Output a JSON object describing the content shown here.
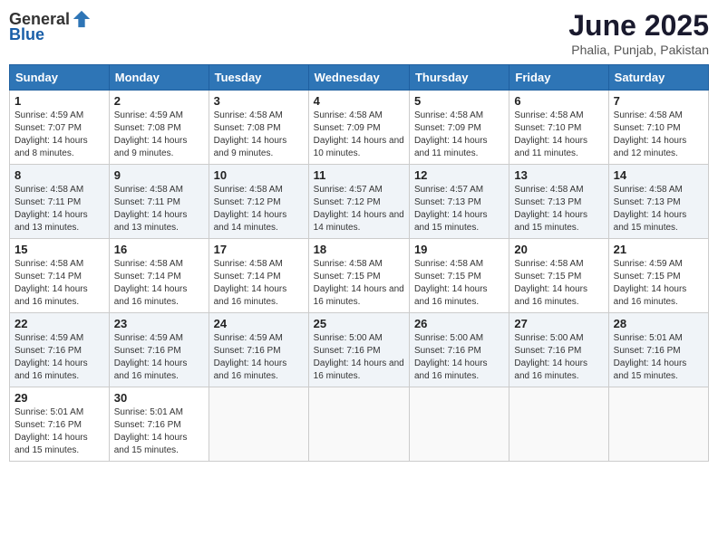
{
  "header": {
    "logo_general": "General",
    "logo_blue": "Blue",
    "month_year": "June 2025",
    "location": "Phalia, Punjab, Pakistan"
  },
  "days_of_week": [
    "Sunday",
    "Monday",
    "Tuesday",
    "Wednesday",
    "Thursday",
    "Friday",
    "Saturday"
  ],
  "weeks": [
    [
      {
        "day": "1",
        "sunrise": "4:59 AM",
        "sunset": "7:07 PM",
        "daylight": "14 hours and 8 minutes."
      },
      {
        "day": "2",
        "sunrise": "4:59 AM",
        "sunset": "7:08 PM",
        "daylight": "14 hours and 9 minutes."
      },
      {
        "day": "3",
        "sunrise": "4:58 AM",
        "sunset": "7:08 PM",
        "daylight": "14 hours and 9 minutes."
      },
      {
        "day": "4",
        "sunrise": "4:58 AM",
        "sunset": "7:09 PM",
        "daylight": "14 hours and 10 minutes."
      },
      {
        "day": "5",
        "sunrise": "4:58 AM",
        "sunset": "7:09 PM",
        "daylight": "14 hours and 11 minutes."
      },
      {
        "day": "6",
        "sunrise": "4:58 AM",
        "sunset": "7:10 PM",
        "daylight": "14 hours and 11 minutes."
      },
      {
        "day": "7",
        "sunrise": "4:58 AM",
        "sunset": "7:10 PM",
        "daylight": "14 hours and 12 minutes."
      }
    ],
    [
      {
        "day": "8",
        "sunrise": "4:58 AM",
        "sunset": "7:11 PM",
        "daylight": "14 hours and 13 minutes."
      },
      {
        "day": "9",
        "sunrise": "4:58 AM",
        "sunset": "7:11 PM",
        "daylight": "14 hours and 13 minutes."
      },
      {
        "day": "10",
        "sunrise": "4:58 AM",
        "sunset": "7:12 PM",
        "daylight": "14 hours and 14 minutes."
      },
      {
        "day": "11",
        "sunrise": "4:57 AM",
        "sunset": "7:12 PM",
        "daylight": "14 hours and 14 minutes."
      },
      {
        "day": "12",
        "sunrise": "4:57 AM",
        "sunset": "7:13 PM",
        "daylight": "14 hours and 15 minutes."
      },
      {
        "day": "13",
        "sunrise": "4:58 AM",
        "sunset": "7:13 PM",
        "daylight": "14 hours and 15 minutes."
      },
      {
        "day": "14",
        "sunrise": "4:58 AM",
        "sunset": "7:13 PM",
        "daylight": "14 hours and 15 minutes."
      }
    ],
    [
      {
        "day": "15",
        "sunrise": "4:58 AM",
        "sunset": "7:14 PM",
        "daylight": "14 hours and 16 minutes."
      },
      {
        "day": "16",
        "sunrise": "4:58 AM",
        "sunset": "7:14 PM",
        "daylight": "14 hours and 16 minutes."
      },
      {
        "day": "17",
        "sunrise": "4:58 AM",
        "sunset": "7:14 PM",
        "daylight": "14 hours and 16 minutes."
      },
      {
        "day": "18",
        "sunrise": "4:58 AM",
        "sunset": "7:15 PM",
        "daylight": "14 hours and 16 minutes."
      },
      {
        "day": "19",
        "sunrise": "4:58 AM",
        "sunset": "7:15 PM",
        "daylight": "14 hours and 16 minutes."
      },
      {
        "day": "20",
        "sunrise": "4:58 AM",
        "sunset": "7:15 PM",
        "daylight": "14 hours and 16 minutes."
      },
      {
        "day": "21",
        "sunrise": "4:59 AM",
        "sunset": "7:15 PM",
        "daylight": "14 hours and 16 minutes."
      }
    ],
    [
      {
        "day": "22",
        "sunrise": "4:59 AM",
        "sunset": "7:16 PM",
        "daylight": "14 hours and 16 minutes."
      },
      {
        "day": "23",
        "sunrise": "4:59 AM",
        "sunset": "7:16 PM",
        "daylight": "14 hours and 16 minutes."
      },
      {
        "day": "24",
        "sunrise": "4:59 AM",
        "sunset": "7:16 PM",
        "daylight": "14 hours and 16 minutes."
      },
      {
        "day": "25",
        "sunrise": "5:00 AM",
        "sunset": "7:16 PM",
        "daylight": "14 hours and 16 minutes."
      },
      {
        "day": "26",
        "sunrise": "5:00 AM",
        "sunset": "7:16 PM",
        "daylight": "14 hours and 16 minutes."
      },
      {
        "day": "27",
        "sunrise": "5:00 AM",
        "sunset": "7:16 PM",
        "daylight": "14 hours and 16 minutes."
      },
      {
        "day": "28",
        "sunrise": "5:01 AM",
        "sunset": "7:16 PM",
        "daylight": "14 hours and 15 minutes."
      }
    ],
    [
      {
        "day": "29",
        "sunrise": "5:01 AM",
        "sunset": "7:16 PM",
        "daylight": "14 hours and 15 minutes."
      },
      {
        "day": "30",
        "sunrise": "5:01 AM",
        "sunset": "7:16 PM",
        "daylight": "14 hours and 15 minutes."
      },
      {
        "day": "",
        "sunrise": "",
        "sunset": "",
        "daylight": ""
      },
      {
        "day": "",
        "sunrise": "",
        "sunset": "",
        "daylight": ""
      },
      {
        "day": "",
        "sunrise": "",
        "sunset": "",
        "daylight": ""
      },
      {
        "day": "",
        "sunrise": "",
        "sunset": "",
        "daylight": ""
      },
      {
        "day": "",
        "sunrise": "",
        "sunset": "",
        "daylight": ""
      }
    ]
  ],
  "labels": {
    "sunrise": "Sunrise: ",
    "sunset": "Sunset: ",
    "daylight": "Daylight: "
  }
}
